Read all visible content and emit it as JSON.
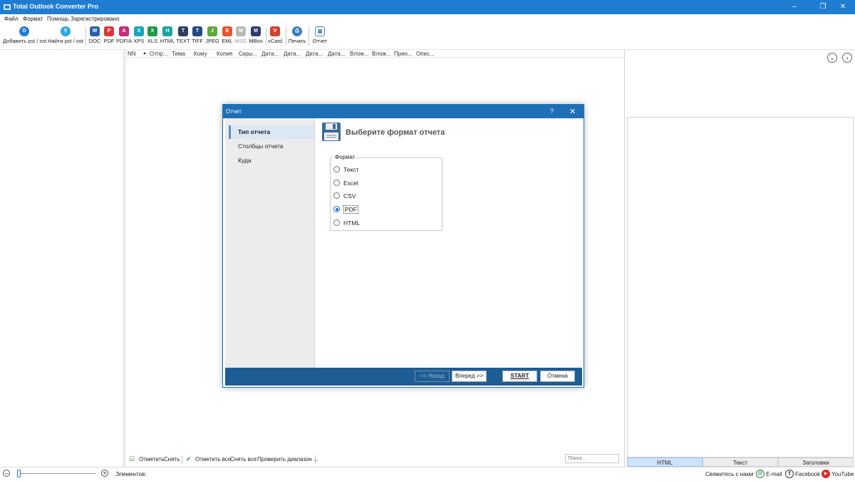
{
  "app": {
    "title": "Total Outlook Converter Pro",
    "accent_color": "#1f7dd1"
  },
  "menu": [
    "Файл",
    "Формат",
    "Помощь",
    "Зарегистрировано"
  ],
  "toolbar": {
    "add_pst": "Добавить pst / ost",
    "find_pst": "Найти pst / ost",
    "formats": [
      {
        "label": "DOC",
        "icon": "word-icon",
        "color": "#2b5fae",
        "glyph": "W"
      },
      {
        "label": "PDF",
        "icon": "pdf-icon",
        "color": "#d83a3a",
        "glyph": "P"
      },
      {
        "label": "PDF/A",
        "icon": "pdfa-icon",
        "color": "#c22f78",
        "glyph": "A"
      },
      {
        "label": "XPS",
        "icon": "xps-icon",
        "color": "#1aa3b8",
        "glyph": "X"
      },
      {
        "label": "XLS",
        "icon": "excel-icon",
        "color": "#1f9a4a",
        "glyph": "X"
      },
      {
        "label": "HTML",
        "icon": "html-icon",
        "color": "#1aa3a0",
        "glyph": "H"
      },
      {
        "label": "TEXT",
        "icon": "text-icon",
        "color": "#2a3f5c",
        "glyph": "T"
      },
      {
        "label": "TIFF",
        "icon": "tiff-icon",
        "color": "#244a7c",
        "glyph": "T"
      },
      {
        "label": "JPEG",
        "icon": "jpeg-icon",
        "color": "#5fa83a",
        "glyph": "J"
      },
      {
        "label": "EML",
        "icon": "eml-icon",
        "color": "#e2572b",
        "glyph": "E"
      },
      {
        "label": "MSG",
        "icon": "msg-icon",
        "color": "#b8b8b8",
        "glyph": "M"
      },
      {
        "label": "MBox",
        "icon": "mbox-icon",
        "color": "#2d3b6e",
        "glyph": "M"
      }
    ],
    "vcard": "vCard",
    "print": "Печать",
    "report": "Отчет"
  },
  "list": {
    "columns": [
      "NN",
      "Отпр...",
      "Тема",
      "Кому",
      "Копия",
      "Скры...",
      "Дата...",
      "Дата...",
      "Дата...",
      "Дата...",
      "Влож...",
      "Влож...",
      "Прио...",
      "Опис..."
    ],
    "footer": {
      "check": "Отметить",
      "uncheck": "Снять",
      "check_all": "Отметить все",
      "uncheck_all": "Снять все",
      "check_range": "Проверить диапазон ...",
      "search_placeholder": "Поиск..."
    }
  },
  "preview_tabs": [
    "HTML",
    "Текст",
    "Заголовки"
  ],
  "status": {
    "items_label": "Элементов:",
    "contact": "Свяжитесь с нами",
    "email": "E-mail",
    "facebook": "Facebook",
    "youtube": "YouTube"
  },
  "dialog": {
    "title": "Отчет",
    "help": "?",
    "close": "✕",
    "nav": [
      "Тип отчета",
      "Столбцы отчета",
      "Куда"
    ],
    "selected_nav": "Тип отчета",
    "heading": "Выберите формат отчета",
    "group_label": "Формат",
    "options": [
      "Текст",
      "Excel",
      "CSV",
      "PDF",
      "HTML"
    ],
    "selected_option": "PDF",
    "buttons": {
      "back": "<< Назад",
      "next": "Вперед >>",
      "start": "START",
      "cancel": "Отмена"
    },
    "header_color": "#1f6fb7",
    "footer_color": "#1d5d94"
  }
}
